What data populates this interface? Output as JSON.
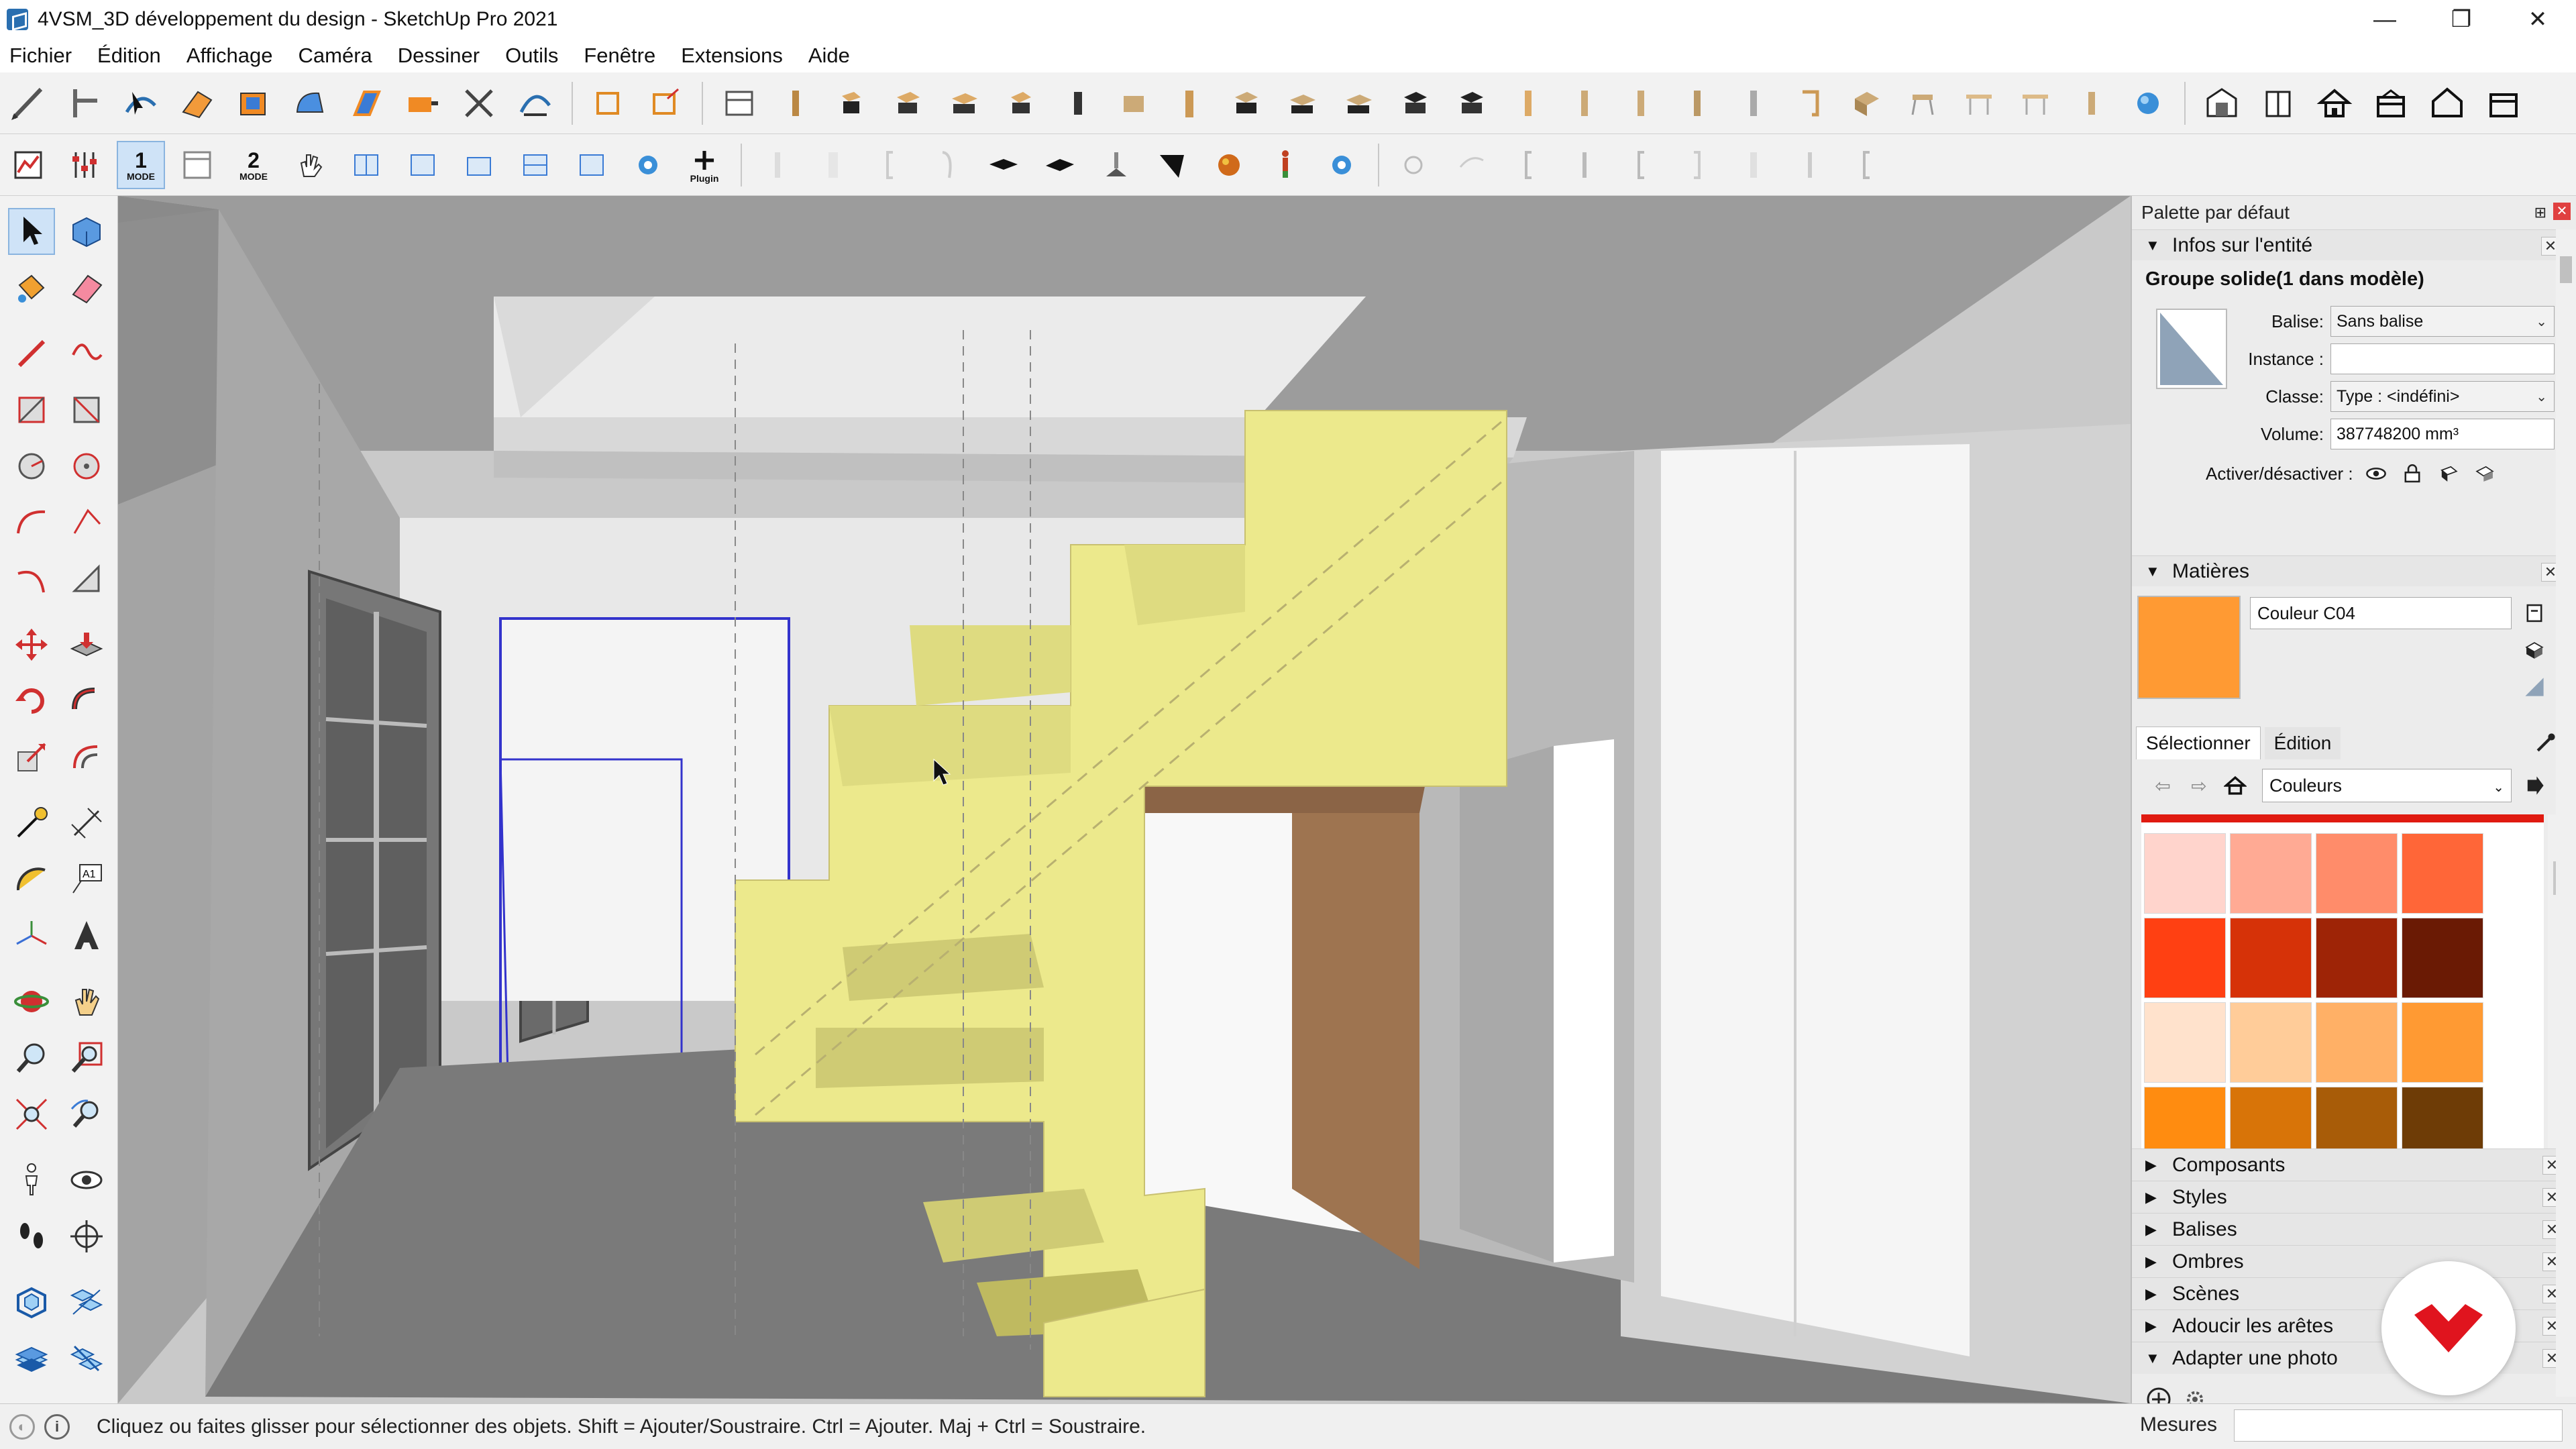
{
  "window": {
    "title": "4VSM_3D développement du design - SketchUp Pro 2021",
    "minimize": "—",
    "maximize": "❐",
    "close": "✕"
  },
  "menu": [
    "Fichier",
    "Édition",
    "Affichage",
    "Caméra",
    "Dessiner",
    "Outils",
    "Fenêtre",
    "Extensions",
    "Aide"
  ],
  "toolbar": {
    "mode1_num": "1",
    "mode1_label": "MODE",
    "mode2_num": "2",
    "mode2_label": "MODE",
    "plugin_label": "Plugin"
  },
  "tray": {
    "title": "Palette par défaut",
    "entity_info": {
      "header": "Infos sur l'entité",
      "type": "Groupe solide(1 dans modèle)",
      "tag_label": "Balise:",
      "tag_value": "Sans balise",
      "instance_label": "Instance :",
      "instance_value": "",
      "class_label": "Classe:",
      "class_value": "Type : <indéfini>",
      "volume_label": "Volume:",
      "volume_value": "387748200 mm³",
      "toggle_label": "Activer/désactiver :"
    },
    "materials": {
      "header": "Matières",
      "current_name": "Couleur C04",
      "current_color": "#ff9a33",
      "tab_select": "Sélectionner",
      "tab_edit": "Édition",
      "library": "Couleurs",
      "swatches": [
        [
          "#ffd4cc",
          "#ffaa94",
          "#ff8c6a",
          "#ff6638"
        ],
        [
          "#ff4012",
          "#d63208",
          "#9e2406",
          "#6a1a04"
        ],
        [
          "#ffe2cc",
          "#ffcc99",
          "#ffb066",
          "#ff9a33"
        ],
        [
          "#ff8c10",
          "#d87408",
          "#a85c08",
          "#6e3c06"
        ]
      ]
    },
    "collapsed_panels": [
      "Composants",
      "Styles",
      "Balises",
      "Ombres",
      "Scènes",
      "Adoucir les arêtes"
    ],
    "expanded_last": "Adapter une photo"
  },
  "status": {
    "message": "Cliquez ou faites glisser pour sélectionner des objets. Shift = Ajouter/Soustraire. Ctrl = Ajouter. Maj + Ctrl = Soustraire.",
    "measures_label": "Mesures",
    "measures_value": ""
  },
  "colors": {
    "stair_fill": "#ece98c",
    "stair_shadow": "#cfcb74",
    "brand_red": "#e0141e",
    "selection_blue": "#3333cc"
  }
}
